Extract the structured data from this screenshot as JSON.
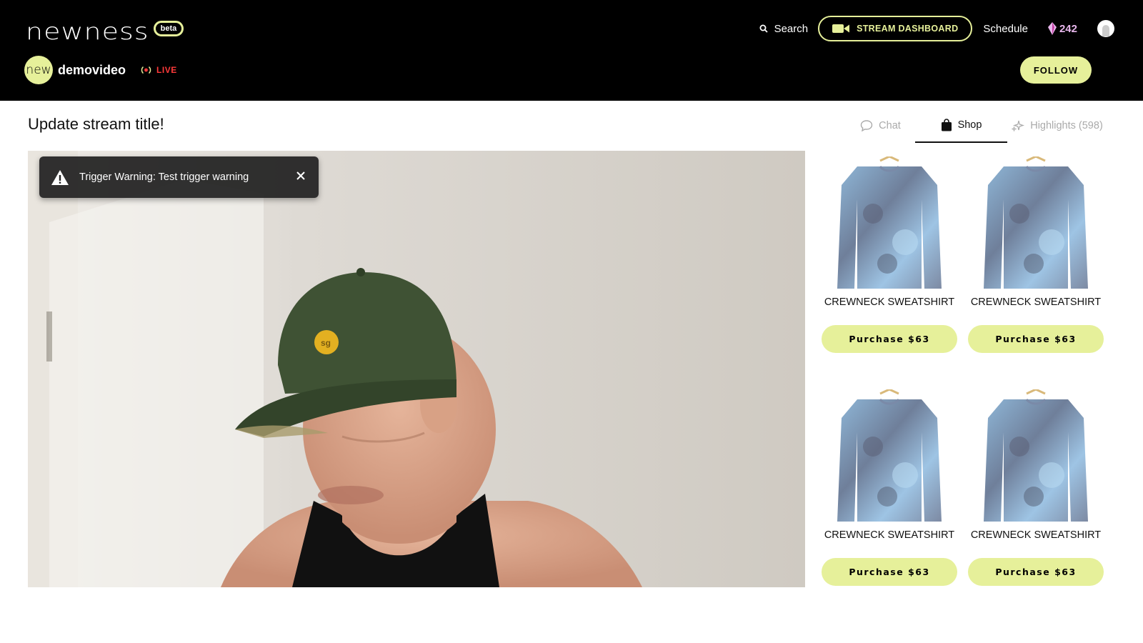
{
  "header": {
    "logo_text": "newness",
    "beta_label": "beta",
    "search_label": "Search",
    "dashboard_label": "STREAM DASHBOARD",
    "schedule_label": "Schedule",
    "gem_count": "242"
  },
  "channel": {
    "avatar_text": "new",
    "name": "demovideo",
    "live_label": "LIVE",
    "follow_label": "FOLLOW"
  },
  "stream": {
    "title": "Update stream title!",
    "warning_text": "Trigger Warning: Test trigger warning"
  },
  "tabs": [
    {
      "label": "Chat",
      "active": false,
      "icon": "chat-bubble-icon"
    },
    {
      "label": "Shop",
      "active": true,
      "icon": "shopping-bag-icon"
    },
    {
      "label": "Highlights (598)",
      "active": false,
      "icon": "sparkle-icon"
    }
  ],
  "products": [
    {
      "name": "CREWNECK SWEATSHIRT",
      "button": "Purchase $63"
    },
    {
      "name": "CREWNECK SWEATSHIRT",
      "button": "Purchase $63"
    },
    {
      "name": "CREWNECK SWEATSHIRT",
      "button": "Purchase $63"
    },
    {
      "name": "CREWNECK SWEATSHIRT",
      "button": "Purchase $63"
    }
  ],
  "colors": {
    "accent": "#e6f09a",
    "live": "#ff3a3a",
    "gem": "#e8b7ec",
    "header_bg": "#000000"
  }
}
